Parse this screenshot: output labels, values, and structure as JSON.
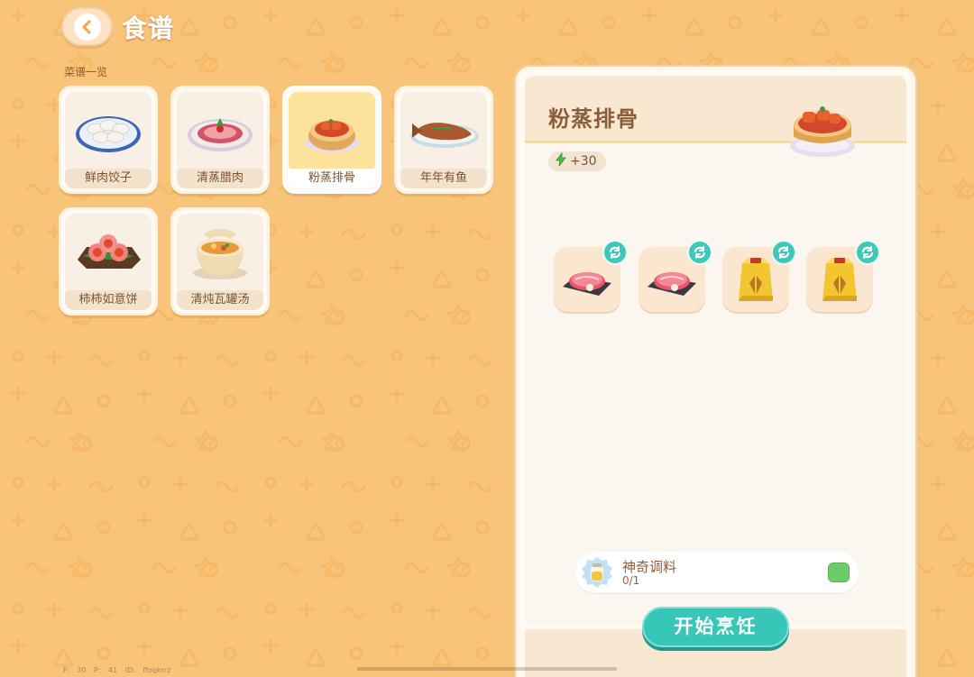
{
  "header": {
    "back_icon": "chevron-left-icon",
    "title": "食谱"
  },
  "recipes": {
    "section_label": "菜谱一览",
    "items": [
      {
        "label": "鲜肉饺子",
        "icon": "dumplings-plate-icon",
        "selected": false
      },
      {
        "label": "清蒸腊肉",
        "icon": "steamed-bacon-plate-icon",
        "selected": false
      },
      {
        "label": "粉蒸排骨",
        "icon": "steamed-ribs-bamboo-steamer-icon",
        "selected": true
      },
      {
        "label": "年年有鱼",
        "icon": "fish-plate-icon",
        "selected": false
      },
      {
        "label": "柿柿如意饼",
        "icon": "persimmon-cakes-icon",
        "selected": false
      },
      {
        "label": "清炖瓦罐汤",
        "icon": "clay-pot-soup-icon",
        "selected": false
      }
    ]
  },
  "detail": {
    "title": "粉蒸排骨",
    "energy": "+30",
    "energy_icon": "lightning-icon",
    "ingredients": [
      {
        "icon": "raw-meat-tray-icon",
        "action_icon": "refresh-icon"
      },
      {
        "icon": "raw-meat-tray-icon",
        "action_icon": "refresh-icon"
      },
      {
        "icon": "flour-bag-icon",
        "action_icon": "refresh-icon"
      },
      {
        "icon": "flour-bag-icon",
        "action_icon": "refresh-icon"
      }
    ],
    "seasoning": {
      "label": "神奇调料",
      "count_current": "0",
      "count_total": "/1",
      "icon": "seasoning-jar-icon"
    },
    "cook_button": "开始烹饪"
  },
  "debug_text": "F: 30  P: 41  ID: ffoqkrrz",
  "colors": {
    "background": "#f8c47a",
    "panel": "#fffaf2",
    "selected_card": "#fde29b",
    "accent_teal": "#37c6b8",
    "text_brown": "#8a5d3b"
  }
}
